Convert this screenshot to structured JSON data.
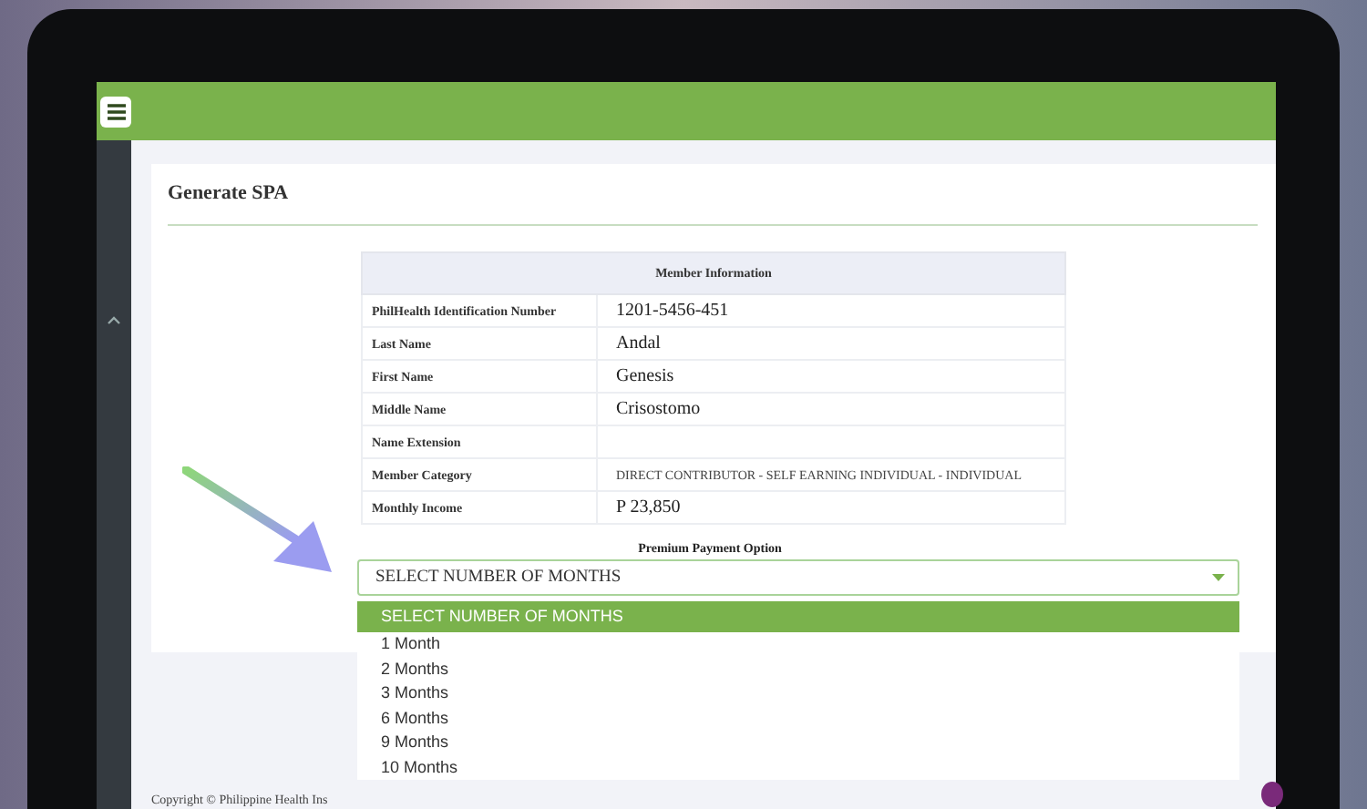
{
  "page_title": "Generate SPA",
  "member_info": {
    "title": "Member Information",
    "rows": [
      {
        "label": "PhilHealth Identification Number",
        "value": "1201-5456-451"
      },
      {
        "label": "Last Name",
        "value": "Andal"
      },
      {
        "label": "First Name",
        "value": "Genesis"
      },
      {
        "label": "Middle Name",
        "value": "Crisostomo"
      },
      {
        "label": "Name Extension"
      },
      {
        "label": "Member Category",
        "value": "DIRECT CONTRIBUTOR - SELF EARNING INDIVIDUAL - INDIVIDUAL"
      },
      {
        "label": "Monthly Income",
        "value": "P 23,850"
      }
    ]
  },
  "payment": {
    "label": "Premium Payment Option",
    "select": {
      "value": "SELECT NUMBER OF MONTHS",
      "expanded": true
    },
    "options": [
      {
        "label": "SELECT NUMBER OF MONTHS",
        "selected": true
      },
      {
        "label": "1 Month",
        "selected": false
      },
      {
        "label": "2 Months",
        "selected": false
      },
      {
        "label": "3 Months",
        "selected": false
      },
      {
        "label": "6 Months",
        "selected": false
      },
      {
        "label": "9 Months",
        "selected": false
      },
      {
        "label": "10 Months",
        "selected": false
      }
    ]
  },
  "footer": {
    "copyright": "Copyright © Philippine Health Ins"
  }
}
